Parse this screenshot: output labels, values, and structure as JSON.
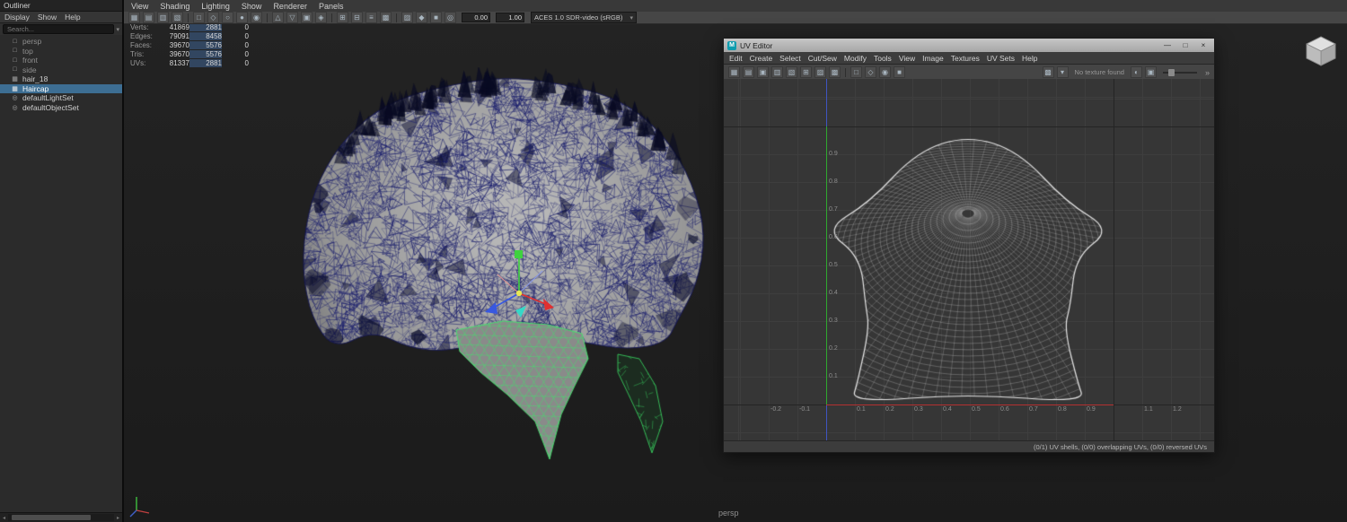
{
  "main_menus": [
    "View",
    "Shading",
    "Lighting",
    "Show",
    "Renderer",
    "Panels"
  ],
  "main_toolbar": {
    "icons": [
      "▦",
      "▤",
      "▥",
      "▧",
      "|",
      "□",
      "◇",
      "○",
      "●",
      "◉",
      "|",
      "△",
      "▽",
      "▣",
      "◈",
      "|",
      "⊞",
      "⊟",
      "≡",
      "▩",
      "|",
      "▨",
      "◆",
      "■",
      "◎"
    ],
    "exposure": "0.00",
    "gamma": "1.00",
    "colorspace": "ACES 1.0 SDR-video (sRGB)",
    "dd_caret": "▾"
  },
  "hud": {
    "rows": [
      {
        "label": "Verts:",
        "total": "41869",
        "selected": "2881",
        "extra": "0"
      },
      {
        "label": "Edges:",
        "total": "79091",
        "selected": "8458",
        "extra": "0"
      },
      {
        "label": "Faces:",
        "total": "39670",
        "selected": "5576",
        "extra": "0"
      },
      {
        "label": "Tris:",
        "total": "39670",
        "selected": "5576",
        "extra": "0"
      },
      {
        "label": "UVs:",
        "total": "81337",
        "selected": "2881",
        "extra": "0"
      }
    ]
  },
  "viewport": {
    "camera_label": "persp"
  },
  "outliner": {
    "title": "Outliner",
    "menus": [
      "Display",
      "Show",
      "Help"
    ],
    "search_placeholder": "Search...",
    "filter_caret": "▾",
    "scroll_left": "◂",
    "scroll_right": "▸",
    "items": [
      {
        "label": "persp",
        "glyph": "□"
      },
      {
        "label": "top",
        "glyph": "□"
      },
      {
        "label": "front",
        "glyph": "□"
      },
      {
        "label": "side",
        "glyph": "□"
      },
      {
        "label": "hair_18",
        "glyph": "▦"
      },
      {
        "label": "Haircap",
        "glyph": "▦"
      },
      {
        "label": "defaultLightSet",
        "glyph": "◎"
      },
      {
        "label": "defaultObjectSet",
        "glyph": "◎"
      }
    ]
  },
  "uv_editor": {
    "title": "UV Editor",
    "app_icon": "M",
    "window_buttons": {
      "minimize": "—",
      "maximize": "□",
      "close": "×"
    },
    "menus": [
      "Edit",
      "Create",
      "Select",
      "Cut/Sew",
      "Modify",
      "Tools",
      "View",
      "Image",
      "Textures",
      "UV Sets",
      "Help"
    ],
    "toolbar": {
      "left_icons": [
        "▦",
        "▤",
        "▣",
        "▥",
        "▧",
        "⊞",
        "▨",
        "▩",
        "|",
        "□",
        "◇",
        "◉",
        "■"
      ],
      "right_icons": [
        "▩",
        "▾"
      ],
      "no_texture": "No texture found",
      "right_icons2": [
        "◐",
        "▣"
      ],
      "chevrons": "»"
    },
    "x_ticks": [
      "-0.2",
      "-0.1",
      "0.1",
      "0.2",
      "0.3",
      "0.4",
      "0.5",
      "0.6",
      "0.7",
      "0.8",
      "0.9",
      "1.1",
      "1.2"
    ],
    "y_ticks": [
      "0.1",
      "0.2",
      "0.3",
      "0.4",
      "0.5",
      "0.6",
      "0.7",
      "0.8",
      "0.9"
    ],
    "status": "(0/1) UV shells, (0/0) overlapping UVs, (0/0) reversed UVs"
  }
}
